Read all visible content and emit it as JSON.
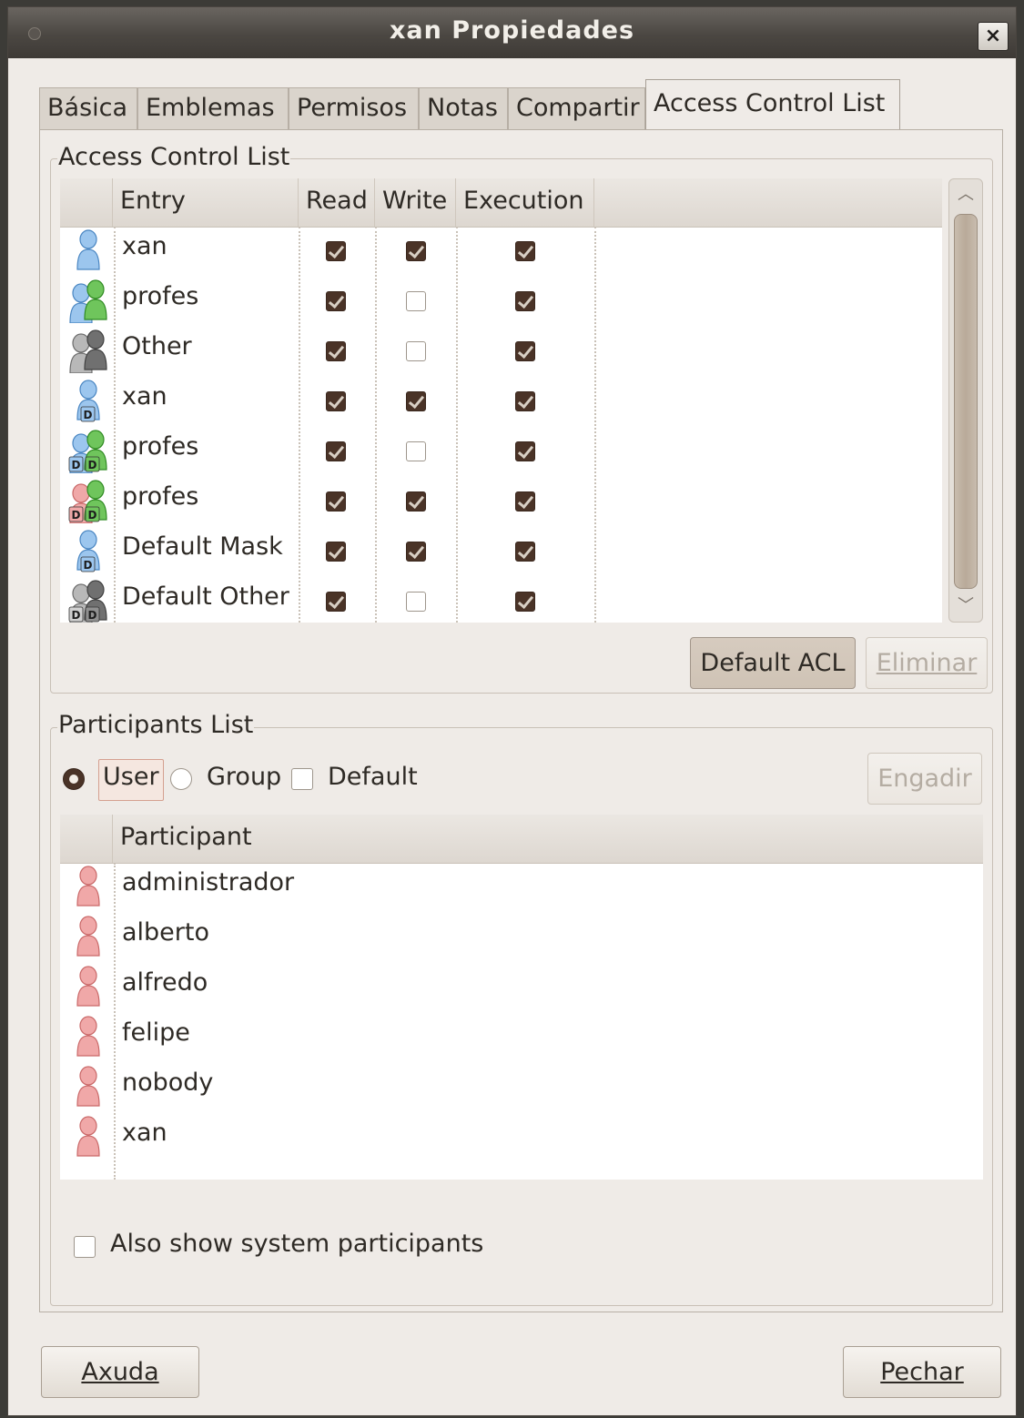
{
  "window": {
    "title": "xan Propiedades",
    "close_label": "×"
  },
  "tabs": [
    {
      "label": "Básica",
      "active": false
    },
    {
      "label": "Emblemas",
      "active": false
    },
    {
      "label": "Permisos",
      "active": false
    },
    {
      "label": "Notas",
      "active": false
    },
    {
      "label": "Compartir",
      "active": false
    },
    {
      "label": "Access Control List",
      "active": true
    }
  ],
  "acl": {
    "legend": "Access Control List",
    "columns": {
      "entry": "Entry",
      "read": "Read",
      "write": "Write",
      "execution": "Execution"
    },
    "rows": [
      {
        "icon": "user-blue-icon",
        "name": "xan",
        "read": true,
        "write": true,
        "execution": true
      },
      {
        "icon": "group-blue-green-icon",
        "name": "profes",
        "read": true,
        "write": false,
        "execution": true
      },
      {
        "icon": "other-gray-icon",
        "name": "Other",
        "read": true,
        "write": false,
        "execution": true
      },
      {
        "icon": "default-user-icon",
        "name": "xan",
        "read": true,
        "write": true,
        "execution": true
      },
      {
        "icon": "default-group-icon",
        "name": "profes",
        "read": true,
        "write": false,
        "execution": true
      },
      {
        "icon": "default-group-red-icon",
        "name": "profes",
        "read": true,
        "write": true,
        "execution": true
      },
      {
        "icon": "default-mask-icon",
        "name": "Default Mask",
        "read": true,
        "write": true,
        "execution": true
      },
      {
        "icon": "default-other-icon",
        "name": "Default Other",
        "read": true,
        "write": false,
        "execution": true
      }
    ],
    "default_acl_button": "Default ACL",
    "remove_button": "Eliminar"
  },
  "participants": {
    "legend": "Participants List",
    "options": {
      "user": "User",
      "group": "Group",
      "default": "Default"
    },
    "selected": "user",
    "add_button": "Engadir",
    "column": "Participant",
    "rows": [
      "administrador",
      "alberto",
      "alfredo",
      "felipe",
      "nobody",
      "xan"
    ],
    "system_checkbox": "Also show system participants"
  },
  "footer": {
    "help_button": "Axuda",
    "close_button": "Pechar"
  },
  "colors": {
    "checked": "#4a3327",
    "window_bg": "#efebe7",
    "titlebar": "#4b4742",
    "user_icon_red": "#e08080",
    "user_icon_blue": "#6aa8e0",
    "user_icon_green": "#4caf3c"
  }
}
